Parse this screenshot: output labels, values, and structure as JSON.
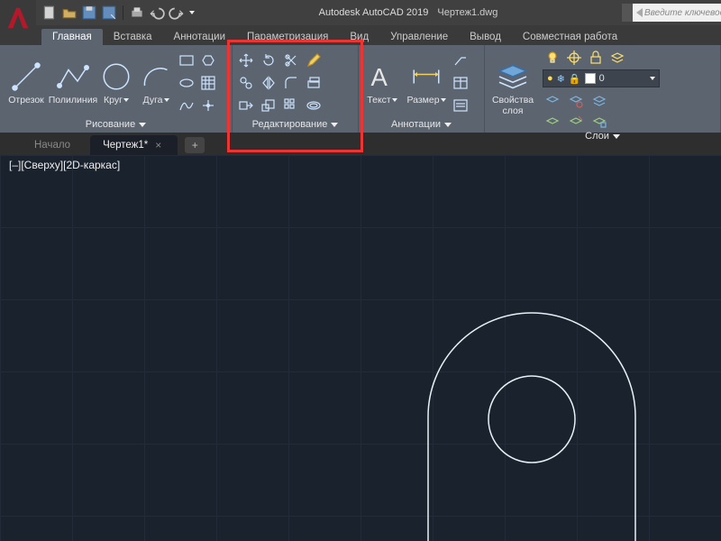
{
  "app": {
    "title": "Autodesk AutoCAD 2019",
    "file": "Чертеж1.dwg",
    "keyword_placeholder": "Введите ключевое сло"
  },
  "tabs": {
    "items": [
      "Главная",
      "Вставка",
      "Аннотации",
      "Параметризация",
      "Вид",
      "Управление",
      "Вывод",
      "Совместная работа"
    ],
    "active": 0
  },
  "panels": {
    "draw": {
      "title": "Рисование",
      "tools": [
        {
          "label": "Отрезок",
          "name": "line-tool"
        },
        {
          "label": "Полилиния",
          "name": "polyline-tool"
        },
        {
          "label": "Круг",
          "name": "circle-tool"
        },
        {
          "label": "Дуга",
          "name": "arc-tool"
        }
      ]
    },
    "edit": {
      "title": "Редактирование"
    },
    "annot": {
      "title": "Аннотации",
      "text_label": "Текст",
      "dim_label": "Размер"
    },
    "layers": {
      "title": "Слои",
      "props_label": "Свойства\nслоя",
      "current": "0"
    }
  },
  "doc_tabs": {
    "items": [
      "Начало",
      "Чертеж1*"
    ],
    "active": 1
  },
  "canvas": {
    "view_label": "[–][Сверху][2D-каркас]"
  }
}
